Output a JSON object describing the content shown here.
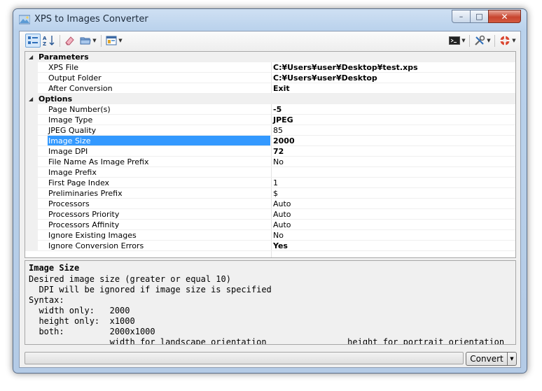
{
  "window": {
    "title": "XPS to Images Converter"
  },
  "caption": {
    "minimize": "–",
    "maximize": "□",
    "close": "✕"
  },
  "toolbar": {
    "icons": [
      "categorized-view-icon",
      "sort-alphabetical-icon",
      "eraser-icon",
      "open-folder-icon",
      "settings-panel-icon",
      "console-icon",
      "tools-icon",
      "help-lifebuoy-icon"
    ]
  },
  "grid": {
    "categories": [
      {
        "name": "Parameters",
        "collapse": "◢",
        "props": [
          {
            "name": "XPS File",
            "value": "C:¥Users¥user¥Desktop¥test.xps",
            "bold": true
          },
          {
            "name": "Output Folder",
            "value": "C:¥Users¥user¥Desktop",
            "bold": true
          },
          {
            "name": "After Conversion",
            "value": "Exit",
            "bold": true
          }
        ]
      },
      {
        "name": "Options",
        "collapse": "◢",
        "props": [
          {
            "name": "Page Number(s)",
            "value": "-5",
            "bold": true
          },
          {
            "name": "Image Type",
            "value": "JPEG",
            "bold": true
          },
          {
            "name": "JPEG Quality",
            "value": "85",
            "bold": false
          },
          {
            "name": "Image Size",
            "value": "2000",
            "bold": true,
            "selected": true
          },
          {
            "name": "Image DPI",
            "value": "72",
            "bold": true
          },
          {
            "name": "File Name As Image Prefix",
            "value": "No",
            "bold": false
          },
          {
            "name": "Image Prefix",
            "value": "",
            "bold": false
          },
          {
            "name": "First Page Index",
            "value": "1",
            "bold": false
          },
          {
            "name": "Preliminaries Prefix",
            "value": "$",
            "bold": false
          },
          {
            "name": "Processors",
            "value": "Auto",
            "bold": false
          },
          {
            "name": "Processors Priority",
            "value": "Auto",
            "bold": false
          },
          {
            "name": "Processors Affinity",
            "value": "Auto",
            "bold": false
          },
          {
            "name": "Ignore Existing Images",
            "value": "No",
            "bold": false
          },
          {
            "name": "Ignore Conversion Errors",
            "value": "Yes",
            "bold": true
          }
        ]
      }
    ]
  },
  "description": {
    "title": "Image Size",
    "lines": [
      "Desired image size (greater or equal 10)",
      "  DPI will be ignored if image size is specified",
      "Syntax:",
      "  width only:   2000",
      "  height only:  x1000",
      "  both:         2000x1000",
      "                width for landscape orientation                height for portrait orientation"
    ]
  },
  "footer": {
    "convert_label": "Convert",
    "dropdown": "▼",
    "progress": 0
  },
  "colors": {
    "selection": "#3399ff",
    "close_button": "#c8452f"
  }
}
